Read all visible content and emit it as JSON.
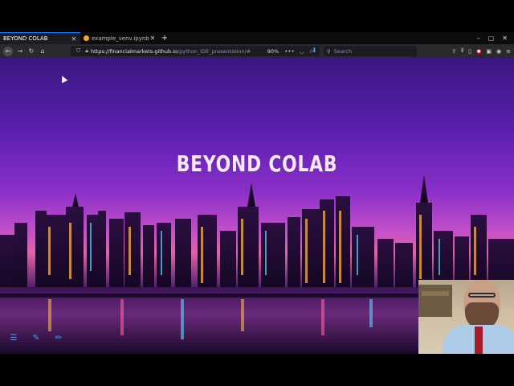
{
  "browser": {
    "tabs": [
      {
        "title": "BEYOND COLAB",
        "active": true,
        "close_icon": "close-icon"
      },
      {
        "title": "example_venv.ipynb - Co",
        "active": false,
        "close_icon": "close-icon"
      }
    ],
    "new_tab_label": "+",
    "window_controls": [
      "–",
      "▢",
      "✕"
    ],
    "url_host": "https://financialmarkets.github.io",
    "url_path": "/python_IDE_presentation/#",
    "zoom": "90%",
    "search_placeholder": "Search",
    "url_more": "•••"
  },
  "slide": {
    "title": "BEYOND COLAB"
  },
  "colors": {
    "accent": "#0a84ff",
    "tool_blue": "#3aa3ff"
  }
}
